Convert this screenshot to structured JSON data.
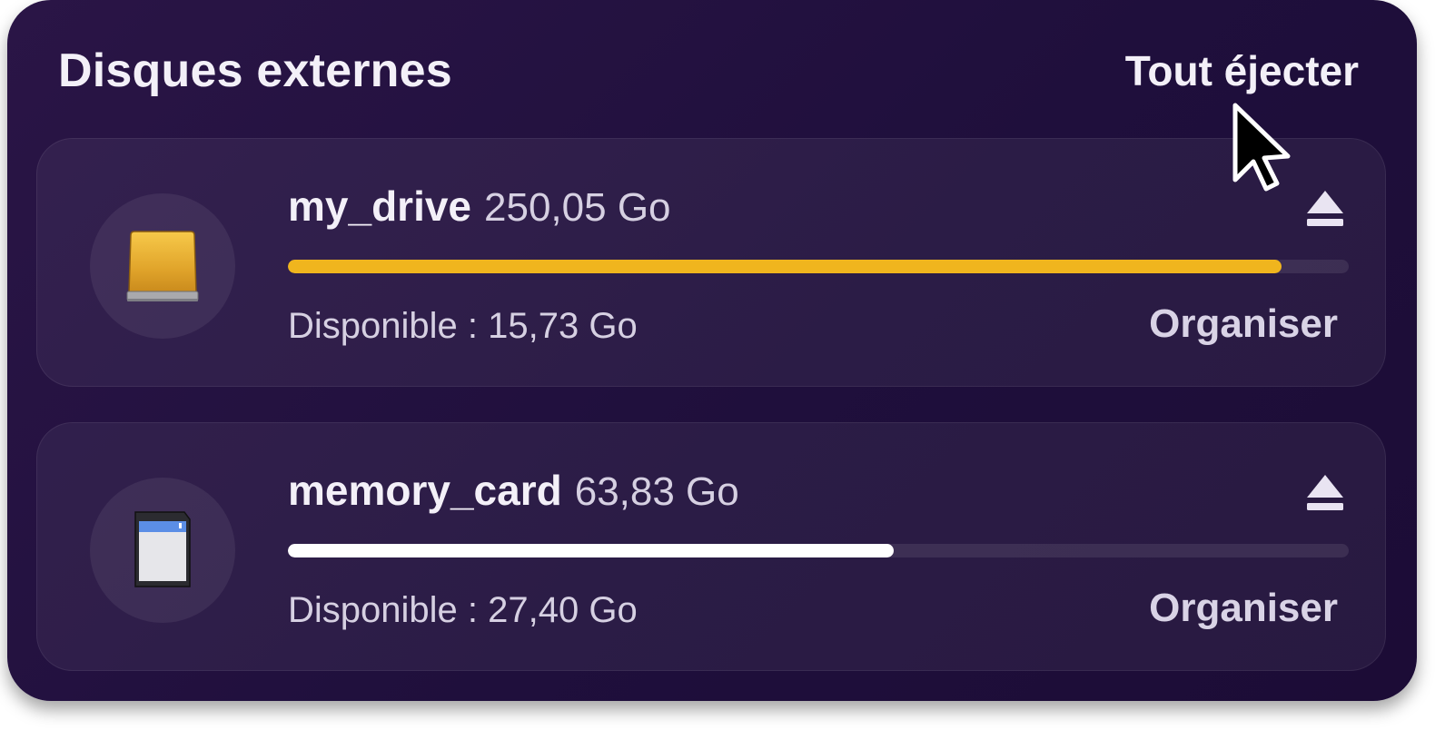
{
  "header": {
    "title": "Disques externes",
    "eject_all_label": "Tout éjecter"
  },
  "disks": [
    {
      "name": "my_drive",
      "size": "250,05 Go",
      "available": "Disponible : 15,73 Go",
      "used_fraction": 0.937,
      "bar_color": "#f0b51e",
      "icon": "external-drive-icon",
      "action_label": "Organiser",
      "eject_icon": "eject-icon"
    },
    {
      "name": "memory_card",
      "size": "63,83 Go",
      "available": "Disponible : 27,40 Go",
      "used_fraction": 0.571,
      "bar_color": "#ffffff",
      "icon": "sd-card-icon",
      "action_label": "Organiser",
      "eject_icon": "eject-icon"
    }
  ],
  "colors": {
    "background": "#1f0f3c",
    "text": "#f3f0f8",
    "muted_text": "#d6d0e2"
  },
  "cursor": "arrow-cursor-icon"
}
